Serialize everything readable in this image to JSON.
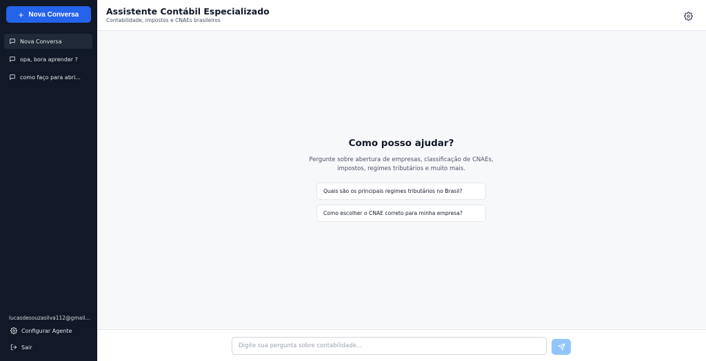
{
  "colors": {
    "sidebar_bg": "#111827",
    "accent": "#2563eb",
    "send_disabled": "#93c5fd",
    "main_bg": "#f7f8fa"
  },
  "sidebar": {
    "new_conversation_label": "Nova Conversa",
    "conversations": [
      {
        "label": "Nova Conversa",
        "active": true,
        "icon": "chat-icon"
      },
      {
        "label": "opa, bora aprender ?",
        "active": false,
        "icon": "chat-icon"
      },
      {
        "label": "como faço para abri...",
        "active": false,
        "icon": "chat-icon"
      }
    ],
    "user_email": "lucasdesouzasilva112@gmail...",
    "configure_label": "Configurar Agente",
    "logout_label": "Sair"
  },
  "header": {
    "title": "Assistente Contábil Especializado",
    "subtitle": "Contabilidade, impostos e CNAEs brasileiros"
  },
  "welcome": {
    "title": "Como posso ajudar?",
    "description": "Pergunte sobre abertura de empresas, classificação de CNAEs, impostos, regimes tributários e muito mais.",
    "suggestions": [
      "Quais são os principais regimes tributários no Brasil?",
      "Como escolher o CNAE correto para minha empresa?"
    ]
  },
  "input": {
    "placeholder": "Digite sua pergunta sobre contabilidade...",
    "value": ""
  }
}
